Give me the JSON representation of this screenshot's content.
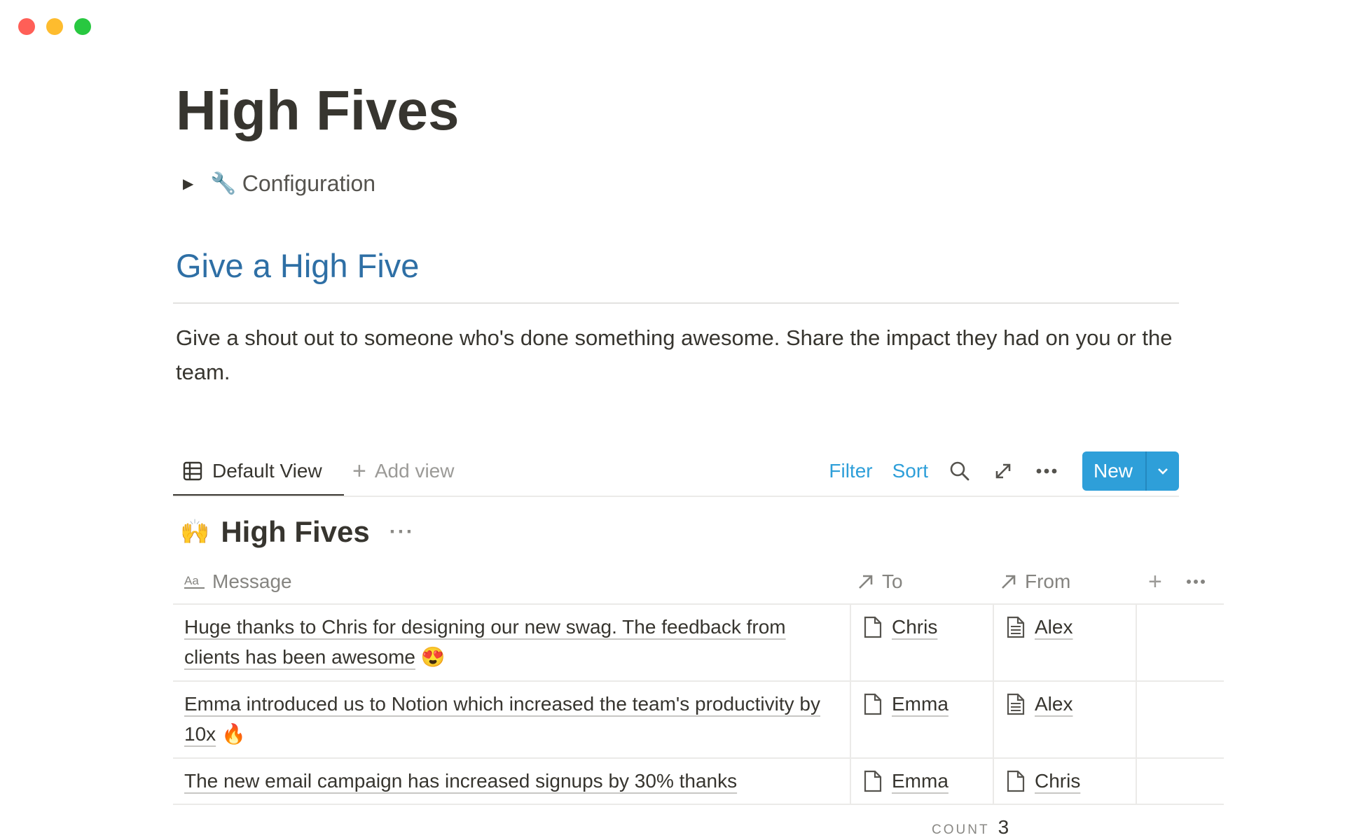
{
  "page": {
    "title": "High Fives",
    "toggle": {
      "emoji": "🔧",
      "label": "Configuration"
    },
    "section_heading": "Give a High Five",
    "description": "Give a shout out to someone who's done something awesome. Share the impact they had on you or the team."
  },
  "view_bar": {
    "active_tab": "Default View",
    "add_view": "Add view",
    "filter": "Filter",
    "sort": "Sort",
    "new_button": "New"
  },
  "database": {
    "emoji": "🙌",
    "title": "High Fives",
    "columns": {
      "message": "Message",
      "to": "To",
      "from": "From"
    },
    "rows": [
      {
        "message": "Huge thanks to Chris for designing our new swag. The feedback from clients has been awesome",
        "message_emoji": "😍",
        "to": "Chris",
        "from": "Alex"
      },
      {
        "message": "Emma introduced us to Notion which increased the team's productivity by 10x",
        "message_emoji": "🔥",
        "to": "Emma",
        "from": "Alex"
      },
      {
        "message": "The new email campaign has increased signups by 30% thanks",
        "message_emoji": "",
        "to": "Emma",
        "from": "Chris"
      }
    ],
    "count_label": "COUNT",
    "count_value": "3"
  },
  "colors": {
    "accent": "#2e9fd9",
    "heading_blue": "#2e6fa5",
    "text": "#37352f"
  }
}
